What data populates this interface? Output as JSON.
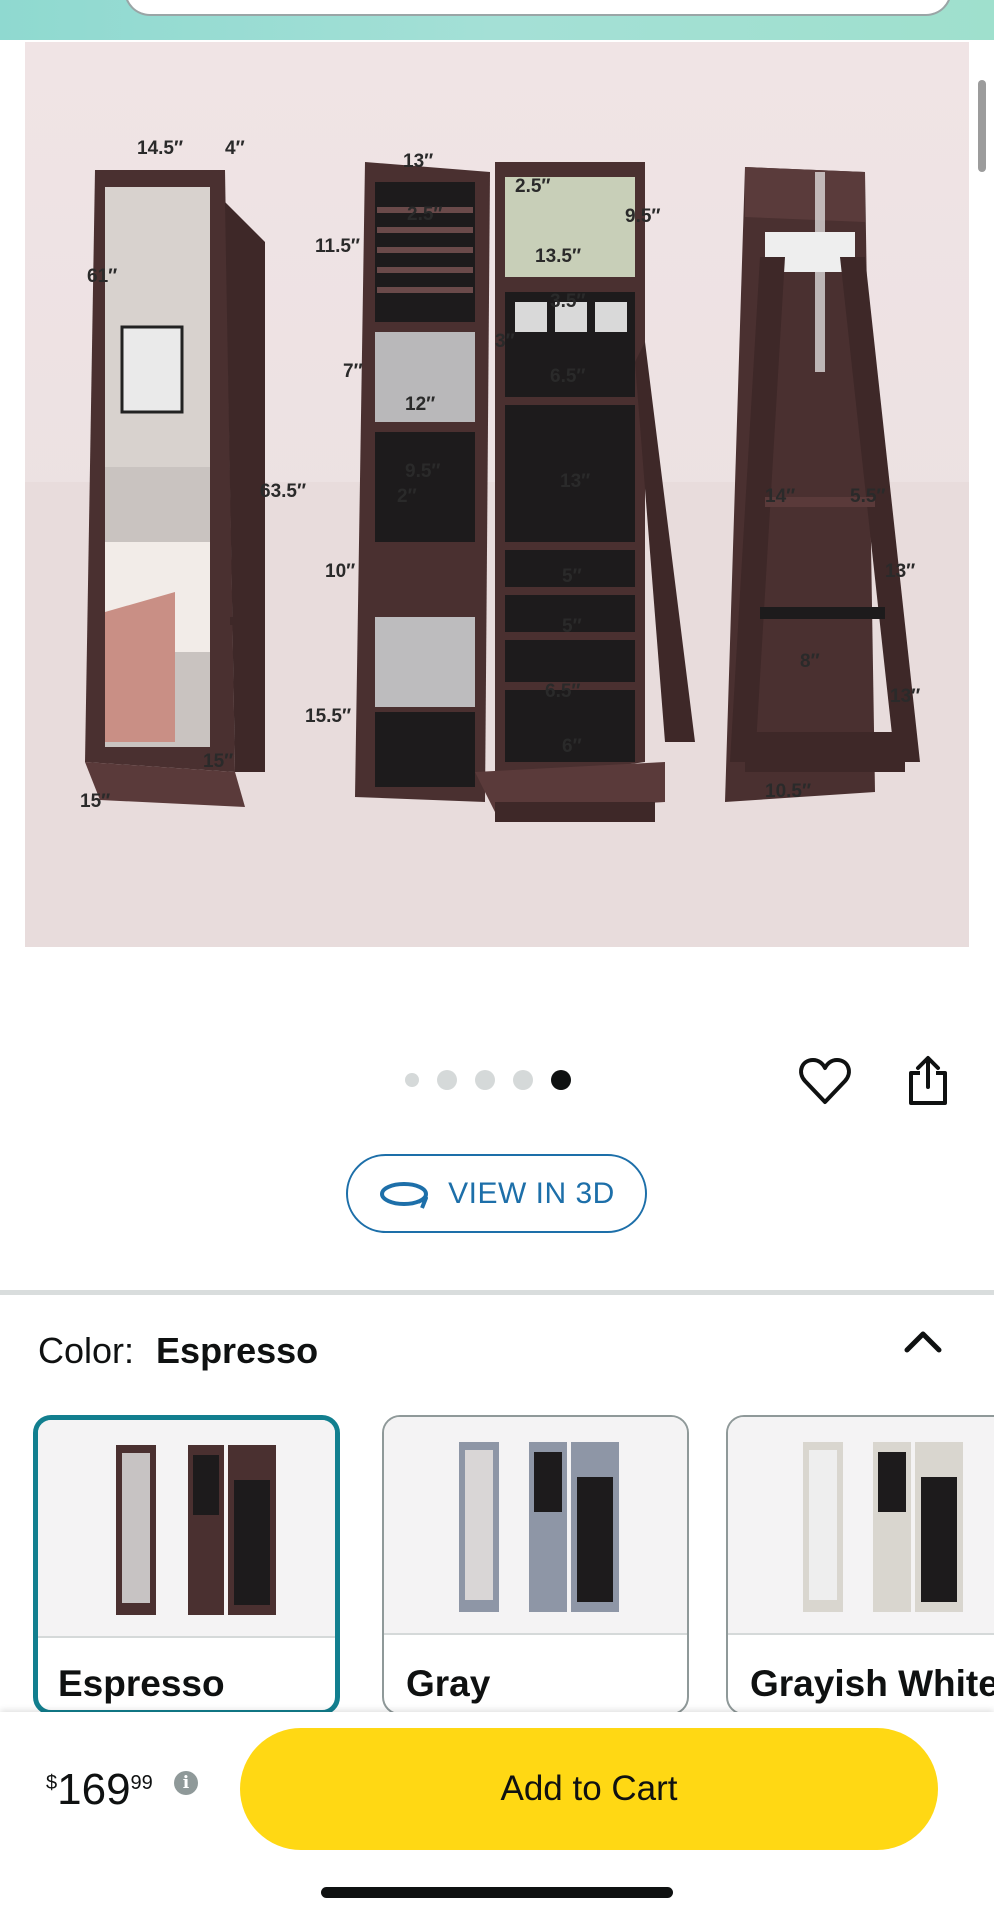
{
  "product_image": {
    "dimension_labels": [
      "14.5″",
      "4″",
      "61″",
      "63.5″",
      "15″",
      "15″",
      "13″",
      "2.5″",
      "2.5″",
      "9.5″",
      "11.5″",
      "13.5″",
      "3.5″",
      "3″",
      "7″",
      "6.5″",
      "12″",
      "9.5″",
      "13″",
      "2″",
      "10″",
      "5″",
      "5″",
      "15.5″",
      "6.5″",
      "6″",
      "14″",
      "5.5″",
      "13″",
      "8″",
      "13″",
      "10.5″"
    ]
  },
  "carousel": {
    "total": 5,
    "active": 5
  },
  "view3d": {
    "label": "VIEW IN 3D"
  },
  "color": {
    "label": "Color:",
    "value": "Espresso"
  },
  "swatches": [
    {
      "name": "Espresso",
      "selected": true,
      "cabinet_color": "#4a3030"
    },
    {
      "name": "Gray",
      "selected": false,
      "cabinet_color": "#8e96a6"
    },
    {
      "name": "Grayish White",
      "selected": false,
      "cabinet_color": "#d9d6cf"
    }
  ],
  "price": {
    "currency": "$",
    "whole": "169",
    "fraction": "99"
  },
  "add_to_cart": {
    "label": "Add to Cart"
  },
  "colors": {
    "accent_teal": "#127f8f",
    "link_blue": "#1d6fa9",
    "cart_yellow": "#ffd814",
    "espresso": "#4a3030"
  },
  "icons": [
    "heart-icon",
    "share-icon",
    "rotate-3d-icon",
    "chevron-up-icon",
    "info-icon"
  ]
}
